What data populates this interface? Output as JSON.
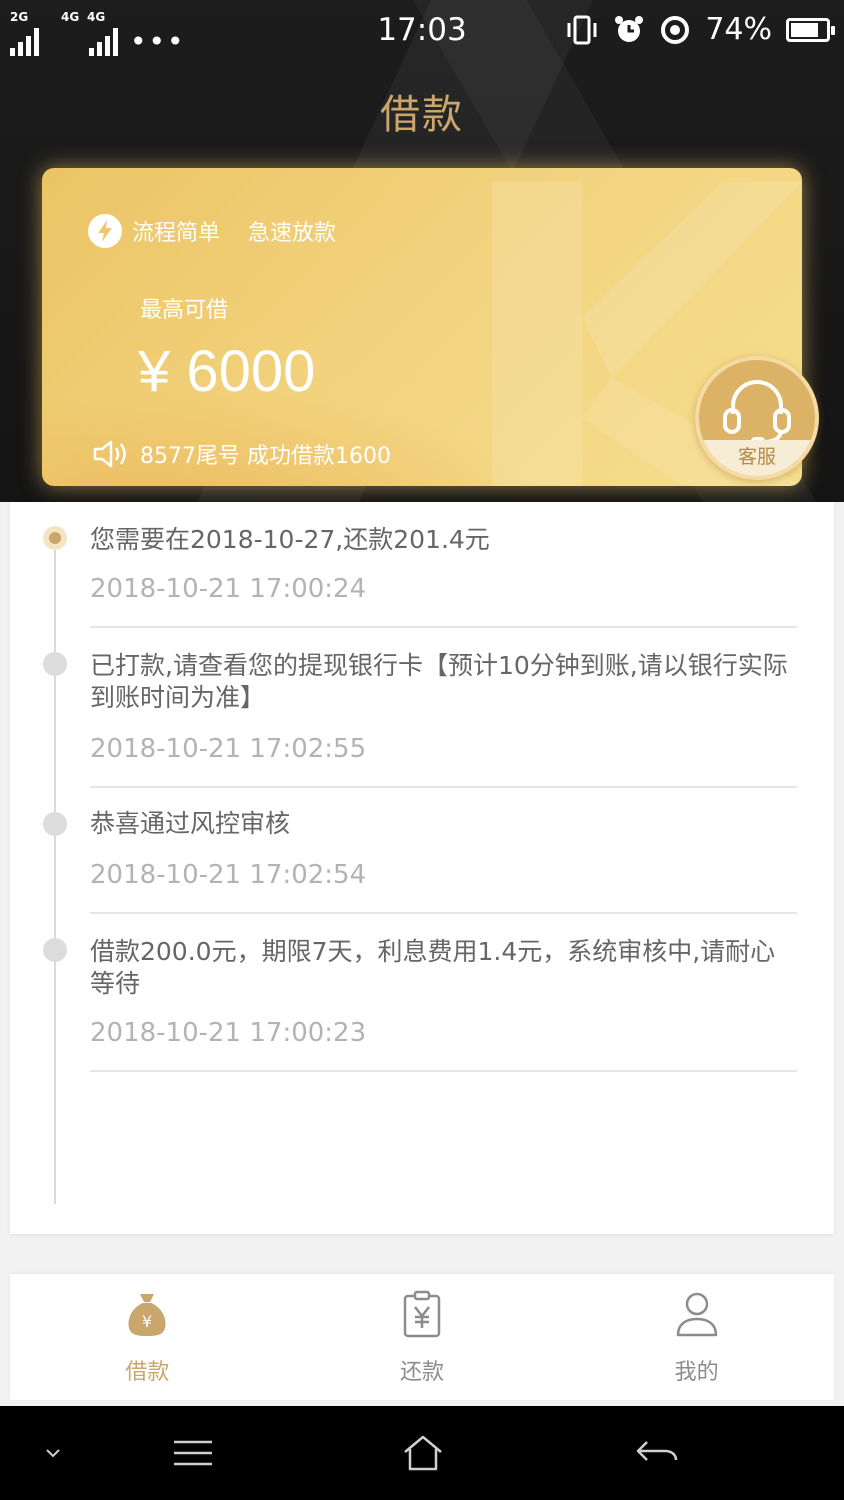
{
  "status_bar": {
    "signal_1_tag": "2G",
    "signal_2_tag": "4G",
    "signal_3_tag": "4G",
    "more": "•••",
    "time": "17:03",
    "battery": "74%"
  },
  "header": {
    "title": "借款"
  },
  "card": {
    "feature_1": "流程简单",
    "feature_2": "急速放款",
    "max_label": "最高可借",
    "max_amount": "¥ 6000",
    "notice": "8577尾号 成功借款1600",
    "service_label": "客服"
  },
  "timeline": [
    {
      "text": "您需要在2018-10-27,还款201.4元",
      "time": "2018-10-21 17:00:24",
      "active": true
    },
    {
      "text": "已打款,请查看您的提现银行卡【预计10分钟到账,请以银行实际到账时间为准】",
      "time": "2018-10-21 17:02:55",
      "active": false
    },
    {
      "text": "恭喜通过风控审核",
      "time": "2018-10-21 17:02:54",
      "active": false
    },
    {
      "text": "借款200.0元，期限7天，利息费用1.4元，系统审核中,请耐心等待",
      "time": "2018-10-21 17:00:23",
      "active": false
    }
  ],
  "tabs": [
    {
      "label": "借款",
      "icon": "money-bag-icon",
      "active": true
    },
    {
      "label": "还款",
      "icon": "repay-clipboard-icon",
      "active": false
    },
    {
      "label": "我的",
      "icon": "user-icon",
      "active": false
    }
  ],
  "nav_bar": {
    "icons": [
      "chevron-down-icon",
      "menu-icon",
      "home-icon",
      "back-icon"
    ]
  },
  "colors": {
    "accent_gold": "#c9a66b",
    "card_gold": "#f2d27d",
    "header_dark": "#1a1a1a"
  }
}
